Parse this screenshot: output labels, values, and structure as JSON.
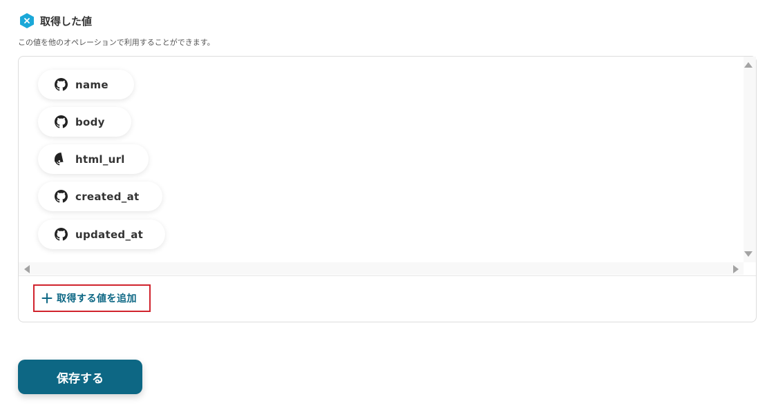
{
  "header": {
    "title": "取得した値",
    "icon": "hexagon-x-icon",
    "icon_color": "#1ba8d8"
  },
  "description": "この値を他のオペレーションで利用することができます。",
  "values": [
    {
      "label": "name",
      "icon": "github-icon"
    },
    {
      "label": "body",
      "icon": "github-icon"
    },
    {
      "label": "html_url",
      "icon": "github-icon"
    },
    {
      "label": "created_at",
      "icon": "github-icon"
    },
    {
      "label": "updated_at",
      "icon": "github-icon"
    }
  ],
  "add_button": {
    "label": "取得する値を追加",
    "icon": "plus-icon"
  },
  "save_button": {
    "label": "保存する"
  },
  "colors": {
    "accent": "#0d6784",
    "highlight_border": "#d0222c"
  }
}
